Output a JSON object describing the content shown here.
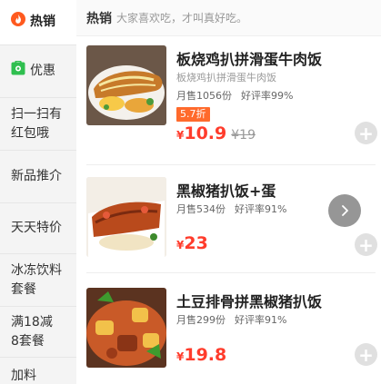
{
  "sidebar": {
    "items": [
      {
        "label": "热销",
        "icon": "flame-icon",
        "active": true
      },
      {
        "label": "优惠",
        "icon": "discount-icon",
        "active": false
      },
      {
        "label": "扫一扫有\n红包哦",
        "icon": "",
        "active": false
      },
      {
        "label": "新品推介",
        "icon": "",
        "active": false
      },
      {
        "label": "天天特价",
        "icon": "",
        "active": false
      },
      {
        "label": "冰冻饮料\n套餐",
        "icon": "",
        "active": false
      },
      {
        "label": "满18减\n8套餐",
        "icon": "",
        "active": false
      },
      {
        "label": "加料",
        "icon": "",
        "active": false
      }
    ]
  },
  "section": {
    "title": "热销",
    "description": "大家喜欢吃，才叫真好吃。"
  },
  "items": [
    {
      "name": "板烧鸡扒拼滑蛋牛肉饭",
      "subtitle": "板烧鸡扒拼滑蛋牛肉饭",
      "monthly_sales": "月售1056份",
      "rating": "好评率99%",
      "discount": "5.7折",
      "currency": "¥",
      "price": "10.9",
      "original_price": "¥19"
    },
    {
      "name": "黑椒猪扒饭+蛋",
      "monthly_sales": "月售534份",
      "rating": "好评率91%",
      "currency": "¥",
      "price": "23"
    },
    {
      "name": "土豆排骨拼黑椒猪扒饭",
      "monthly_sales": "月售299份",
      "rating": "好评率91%",
      "currency": "¥",
      "price": "19.8"
    }
  ],
  "colors": {
    "accent": "#ff3c2c",
    "discount_badge": "#ff6a2c",
    "sidebar_bg": "#f4f4f4",
    "flame_icon": "#ff5a1f",
    "discount_icon": "#2fbf4f"
  },
  "icons": {
    "add": "plus-icon",
    "next": "chevron-right-icon"
  }
}
